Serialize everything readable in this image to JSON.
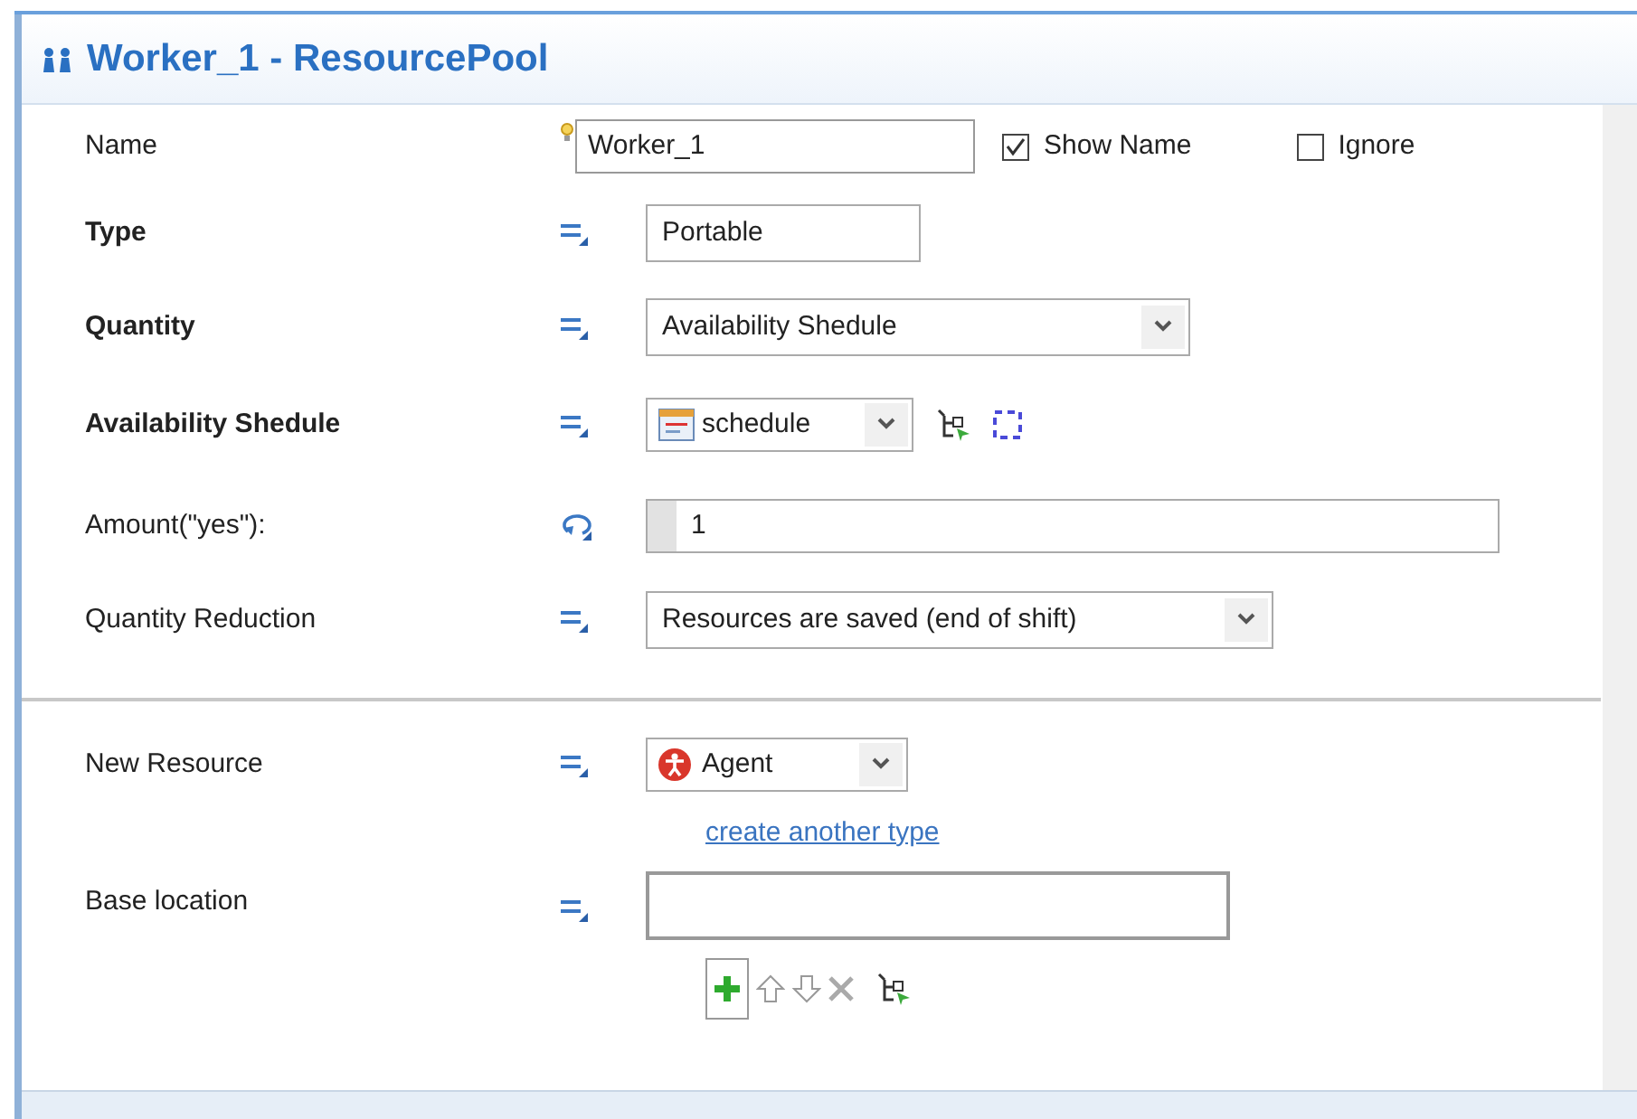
{
  "window": {
    "title": "Worker_1 - ResourcePool"
  },
  "rows": [
    {
      "kind": "name",
      "label": "Name",
      "bold": false,
      "value": "Worker_1",
      "show_name": {
        "label": "Show Name",
        "checked": true
      },
      "ignore": {
        "label": "Ignore",
        "checked": false
      }
    },
    {
      "kind": "text",
      "label": "Type",
      "bold": true,
      "value": "Portable"
    },
    {
      "kind": "dropdown",
      "label": "Quantity",
      "bold": true,
      "value": "Availability Shedule"
    },
    {
      "kind": "schedule",
      "label": "Availability Shedule",
      "bold": true,
      "value": "schedule"
    },
    {
      "kind": "code",
      "label": "Amount(\"yes\"):",
      "bold": false,
      "value": "1"
    },
    {
      "kind": "dropdown",
      "label": "Quantity Reduction",
      "bold": false,
      "value": "Resources are saved (end of shift)"
    }
  ],
  "resource": {
    "label": "New Resource",
    "value": "Agent",
    "link": "create another type"
  },
  "base_location": {
    "label": "Base location"
  }
}
